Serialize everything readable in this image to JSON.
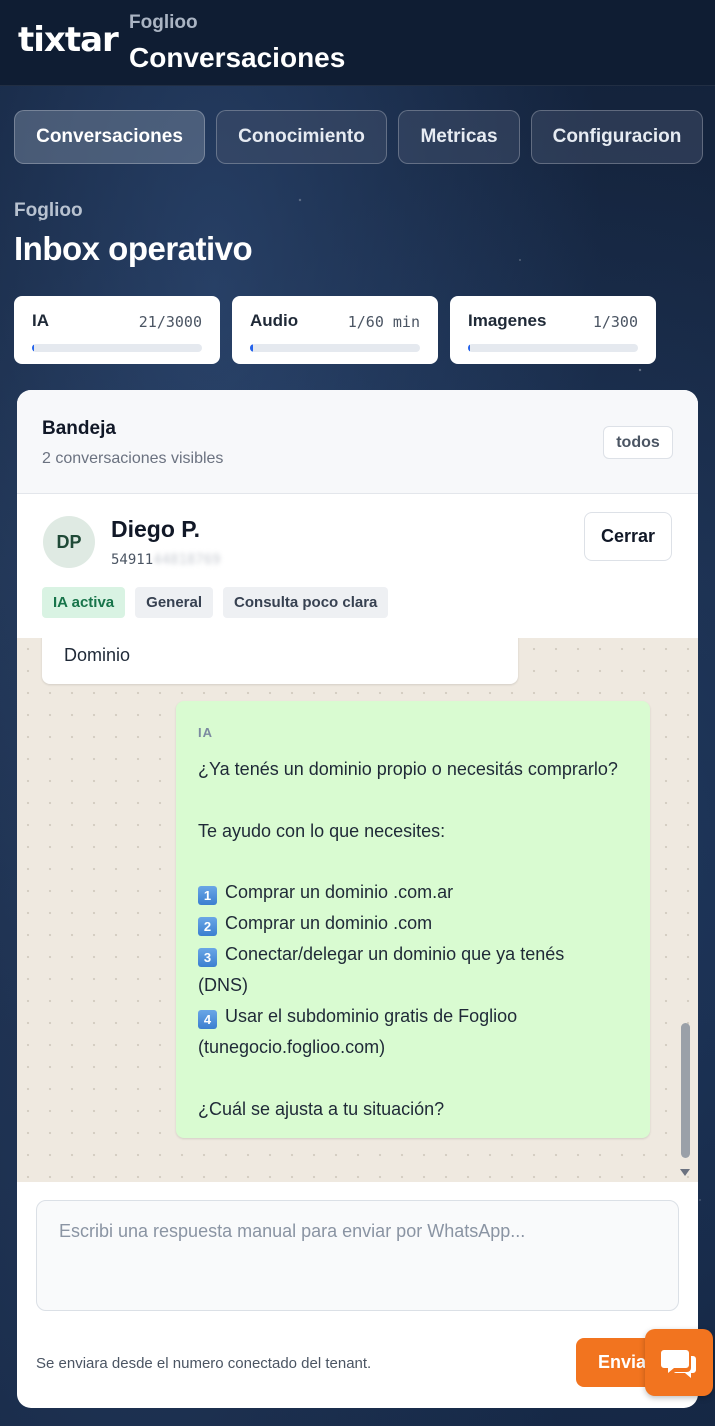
{
  "header": {
    "logo_text": "tixtar",
    "brand": "Foglioo",
    "title": "Conversaciones"
  },
  "nav": {
    "tabs": [
      {
        "label": "Conversaciones",
        "active": true
      },
      {
        "label": "Conocimiento",
        "active": false
      },
      {
        "label": "Metricas",
        "active": false
      },
      {
        "label": "Configuracion",
        "active": false
      }
    ]
  },
  "page": {
    "tenant": "Foglioo",
    "title": "Inbox operativo"
  },
  "usage": [
    {
      "label": "IA",
      "count": "21/3000",
      "fraction": 0.007
    },
    {
      "label": "Audio",
      "count": "1/60 min",
      "fraction": 0.017
    },
    {
      "label": "Imagenes",
      "count": "1/300",
      "fraction": 0.0033
    }
  ],
  "inbox": {
    "title": "Bandeja",
    "subtitle": "2 conversaciones visibles",
    "filter_label": "todos"
  },
  "contact": {
    "initials": "DP",
    "name": "Diego P.",
    "phone_visible": "54911",
    "phone_hidden": "44818769",
    "close_label": "Cerrar",
    "tags": [
      "IA activa",
      "General",
      "Consulta poco clara"
    ]
  },
  "chat": {
    "incoming_text": "Dominio",
    "outgoing": {
      "sender": "IA",
      "lines": [
        "¿Ya tenés un dominio propio o necesitás comprarlo?",
        "",
        "Te ayudo con lo que necesites:",
        "",
        "Comprar un dominio .com.ar",
        "Comprar un dominio .com",
        "Conectar/delegar un dominio que ya tenés",
        "(DNS)",
        "Usar el subdominio gratis de Foglioo",
        "(tunegocio.foglioo.com)",
        "",
        "¿Cuál se ajusta a tu situación?"
      ],
      "keycaps": [
        "1",
        "2",
        "3",
        "4"
      ]
    }
  },
  "composer": {
    "placeholder": "Escribi una respuesta manual para enviar por WhatsApp...",
    "note": "Se enviara desde el numero conectado del tenant.",
    "send_label": "Enviar"
  },
  "colors": {
    "accent": "#f2741f",
    "bubble_out": "#d9fbd1",
    "progress": "#2563eb",
    "tag_green_bg": "#d9f3e3"
  },
  "icons": {
    "chat_fab": "chat-bubbles-icon"
  }
}
